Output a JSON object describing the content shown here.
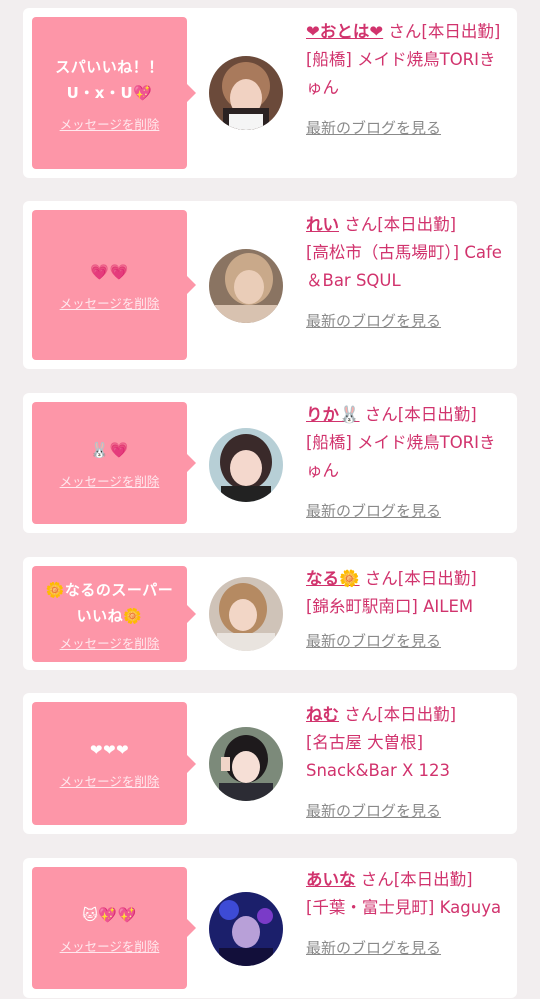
{
  "delete_label": "メッセージを削除",
  "blog_label": "最新のブログを見る",
  "colors": {
    "bubble": "#fd96a8",
    "name": "#d1336d",
    "link_gray": "#8a8a8a",
    "background": "#f2eeef"
  },
  "items": [
    {
      "message": "スパいいね！！\nU・x・U💖",
      "name": "❤おとは❤",
      "honorific_status": " さん[本日出勤]",
      "shop": "[船橋] メイド焼鳥TORIきゅん",
      "avatar_icon": "girl-photo-avatar"
    },
    {
      "message": "💗💗",
      "name": "れい",
      "honorific_status": " さん[本日出勤]",
      "shop": "[高松市（古馬場町）] Cafe＆Bar SQUL",
      "avatar_icon": "girl-photo-avatar"
    },
    {
      "message": "🐰💗",
      "name": "りか🐰",
      "honorific_status": " さん[本日出勤]",
      "shop": "[船橋] メイド焼鳥TORIきゅん",
      "avatar_icon": "girl-photo-avatar"
    },
    {
      "message": "🌼なるのスーパーいいね🌼",
      "name": "なる🌼",
      "honorific_status": " さん[本日出勤]",
      "shop": "[錦糸町駅南口] AILEM",
      "avatar_icon": "girl-photo-avatar"
    },
    {
      "message": "❤❤❤",
      "name": "ねむ",
      "honorific_status": " さん[本日出勤]",
      "shop": "[名古屋 大曽根] Snack&Bar X 123",
      "avatar_icon": "girl-photo-avatar"
    },
    {
      "message": "🐱💖💖",
      "name": "あいな",
      "honorific_status": " さん[本日出勤]",
      "shop": "[千葉・富士見町] Kaguya",
      "avatar_icon": "girl-photo-avatar"
    }
  ]
}
